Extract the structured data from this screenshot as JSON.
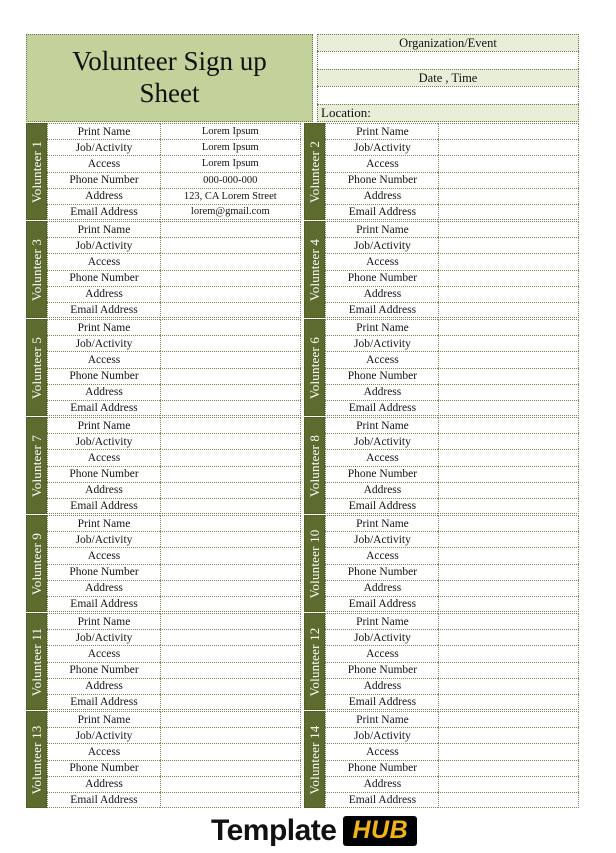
{
  "document": {
    "title": "Volunteer Sign up Sheet"
  },
  "header": {
    "organization_label": "Organization/Event",
    "organization_value": "",
    "date_time_label": "Date , Time",
    "date_time_value": "",
    "location_label": "Location:"
  },
  "field_labels": {
    "print_name": "Print Name",
    "job_activity": "Job/Activity",
    "access": "Access",
    "phone_number": "Phone Number",
    "address": "Address",
    "email_address": "Email Address"
  },
  "volunteers": [
    {
      "tab": "Volunteer 1",
      "print_name": "Lorem Ipsum",
      "job_activity": "Lorem Ipsum",
      "access": "Lorem Ipsum",
      "phone_number": "000-000-000",
      "address": "123, CA Lorem Street",
      "email_address": "lorem@gmail.com"
    },
    {
      "tab": "Volunteer 2",
      "print_name": "",
      "job_activity": "",
      "access": "",
      "phone_number": "",
      "address": "",
      "email_address": ""
    },
    {
      "tab": "Volunteer 3",
      "print_name": "",
      "job_activity": "",
      "access": "",
      "phone_number": "",
      "address": "",
      "email_address": ""
    },
    {
      "tab": "Volunteer 4",
      "print_name": "",
      "job_activity": "",
      "access": "",
      "phone_number": "",
      "address": "",
      "email_address": ""
    },
    {
      "tab": "Volunteer 5",
      "print_name": "",
      "job_activity": "",
      "access": "",
      "phone_number": "",
      "address": "",
      "email_address": ""
    },
    {
      "tab": "Volunteer 6",
      "print_name": "",
      "job_activity": "",
      "access": "",
      "phone_number": "",
      "address": "",
      "email_address": ""
    },
    {
      "tab": "Volunteer 7",
      "print_name": "",
      "job_activity": "",
      "access": "",
      "phone_number": "",
      "address": "",
      "email_address": ""
    },
    {
      "tab": "Volunteer 8",
      "print_name": "",
      "job_activity": "",
      "access": "",
      "phone_number": "",
      "address": "",
      "email_address": ""
    },
    {
      "tab": "Volunteer 9",
      "print_name": "",
      "job_activity": "",
      "access": "",
      "phone_number": "",
      "address": "",
      "email_address": ""
    },
    {
      "tab": "Volunteer 10",
      "print_name": "",
      "job_activity": "",
      "access": "",
      "phone_number": "",
      "address": "",
      "email_address": ""
    },
    {
      "tab": "Volunteer 11",
      "print_name": "",
      "job_activity": "",
      "access": "",
      "phone_number": "",
      "address": "",
      "email_address": ""
    },
    {
      "tab": "Volunteer 12",
      "print_name": "",
      "job_activity": "",
      "access": "",
      "phone_number": "",
      "address": "",
      "email_address": ""
    },
    {
      "tab": "Volunteer 13",
      "print_name": "",
      "job_activity": "",
      "access": "",
      "phone_number": "",
      "address": "",
      "email_address": ""
    },
    {
      "tab": "Volunteer 14",
      "print_name": "",
      "job_activity": "",
      "access": "",
      "phone_number": "",
      "address": "",
      "email_address": ""
    }
  ],
  "watermark": {
    "word": "Template",
    "badge": "HUB"
  },
  "colors": {
    "title_background": "#c3d19a",
    "header_band": "#e8eed8",
    "tab_green": "#5c6b2e",
    "grid_line": "#7b8656",
    "badge_background": "#000000",
    "badge_text": "#f2b21a"
  }
}
